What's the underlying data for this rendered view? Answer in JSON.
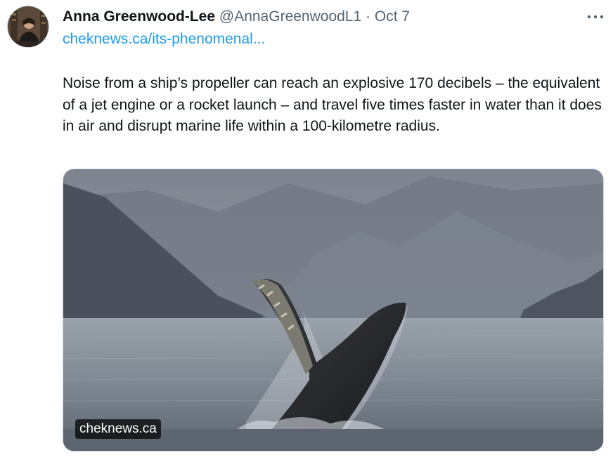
{
  "tweet": {
    "author_name": "Anna Greenwood-Lee",
    "handle": "@AnnaGreenwoodL1",
    "separator": "·",
    "date": "Oct 7",
    "link_text": "cheknews.ca/its-phenomenal...",
    "text": "Noise from a ship’s propeller can reach an explosive 170 decibels – the equivalent of a jet engine or a rocket launch – and travel five times faster in water than it does in air and disrupt marine life within a 100-kilometre radius.",
    "media": {
      "source_label": "cheknews.ca"
    }
  },
  "icons": {
    "more": "more-horizontal-icon",
    "avatar": "user-avatar"
  },
  "colors": {
    "link": "#1d9bf0",
    "secondary_text": "#536471",
    "primary_text": "#0f1419"
  }
}
